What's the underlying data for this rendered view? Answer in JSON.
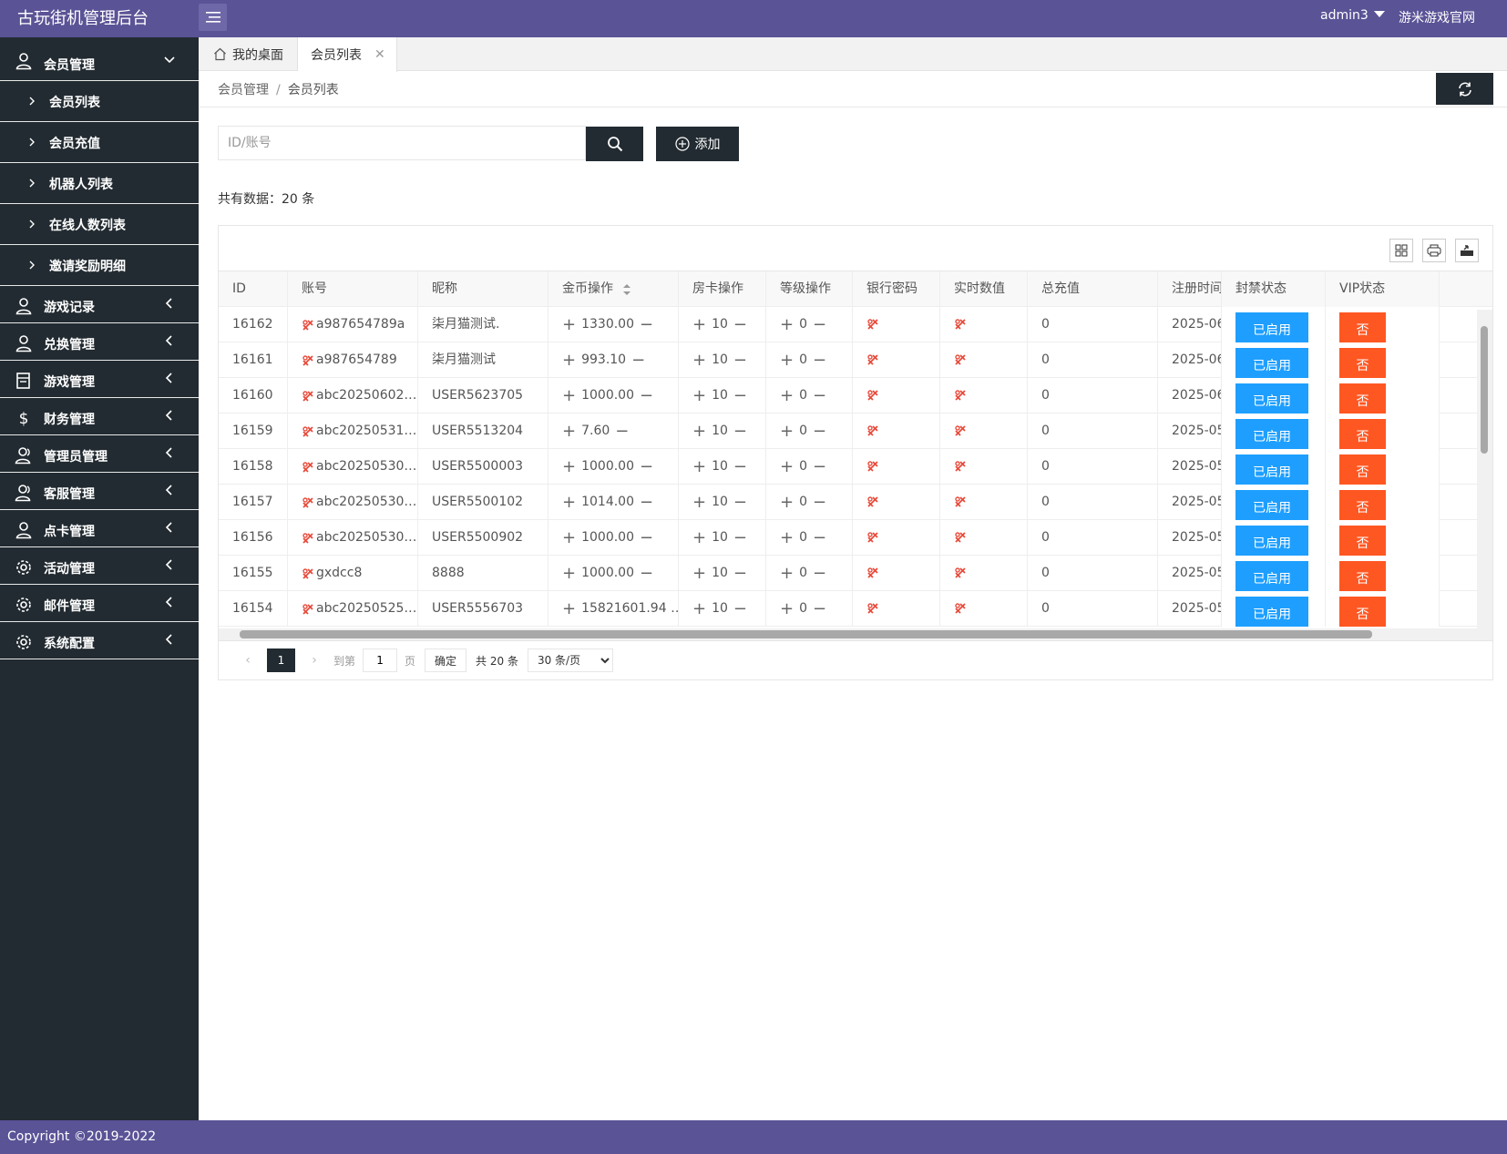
{
  "header": {
    "brand": "古玩街机管理后台",
    "user": "admin3",
    "site_link": "游米游戏官网"
  },
  "sidebar": {
    "groups": [
      {
        "label": "会员管理",
        "icon": "user-icon",
        "expanded": true,
        "children": [
          "会员列表",
          "会员充值",
          "机器人列表",
          "在线人数列表",
          "邀请奖励明细"
        ]
      },
      {
        "label": "游戏记录",
        "icon": "user-icon"
      },
      {
        "label": "兑换管理",
        "icon": "user-icon"
      },
      {
        "label": "游戏管理",
        "icon": "document-icon"
      },
      {
        "label": "财务管理",
        "icon": "dollar-icon"
      },
      {
        "label": "管理员管理",
        "icon": "users-icon"
      },
      {
        "label": "客服管理",
        "icon": "users-icon"
      },
      {
        "label": "点卡管理",
        "icon": "user-icon"
      },
      {
        "label": "活动管理",
        "icon": "gear-icon"
      },
      {
        "label": "邮件管理",
        "icon": "gear-icon"
      },
      {
        "label": "系统配置",
        "icon": "gear-icon"
      }
    ]
  },
  "tabs": {
    "home": "我的桌面",
    "active": "会员列表"
  },
  "breadcrumb": {
    "parent": "会员管理",
    "sep": "/",
    "current": "会员列表"
  },
  "search": {
    "placeholder": "ID/账号",
    "add_label": "添加"
  },
  "total_text": "共有数据：20 条",
  "table": {
    "columns": [
      "ID",
      "账号",
      "昵称",
      "金币操作",
      "房卡操作",
      "等级操作",
      "银行密码",
      "实时数值",
      "总充值",
      "注册时间",
      "封禁状态",
      "VIP状态"
    ],
    "rows": [
      {
        "id": "16162",
        "account": "a987654789a",
        "nickname": "柒月猫测试.",
        "gold": "1330.00",
        "card": "10",
        "level": "0",
        "total": "0",
        "reg": "2025-06-",
        "status": "已启用",
        "vip": "否"
      },
      {
        "id": "16161",
        "account": "a987654789",
        "nickname": "柒月猫测试",
        "gold": "993.10",
        "card": "10",
        "level": "0",
        "total": "0",
        "reg": "2025-06-",
        "status": "已启用",
        "vip": "否"
      },
      {
        "id": "16160",
        "account": "abc20250602…",
        "nickname": "USER5623705",
        "gold": "1000.00",
        "card": "10",
        "level": "0",
        "total": "0",
        "reg": "2025-06-",
        "status": "已启用",
        "vip": "否"
      },
      {
        "id": "16159",
        "account": "abc20250531…",
        "nickname": "USER5513204",
        "gold": "7.60",
        "card": "10",
        "level": "0",
        "total": "0",
        "reg": "2025-05-",
        "status": "已启用",
        "vip": "否"
      },
      {
        "id": "16158",
        "account": "abc20250530…",
        "nickname": "USER5500003",
        "gold": "1000.00",
        "card": "10",
        "level": "0",
        "total": "0",
        "reg": "2025-05-",
        "status": "已启用",
        "vip": "否"
      },
      {
        "id": "16157",
        "account": "abc20250530…",
        "nickname": "USER5500102",
        "gold": "1014.00",
        "card": "10",
        "level": "0",
        "total": "0",
        "reg": "2025-05-",
        "status": "已启用",
        "vip": "否"
      },
      {
        "id": "16156",
        "account": "abc20250530…",
        "nickname": "USER5500902",
        "gold": "1000.00",
        "card": "10",
        "level": "0",
        "total": "0",
        "reg": "2025-05-",
        "status": "已启用",
        "vip": "否"
      },
      {
        "id": "16155",
        "account": "gxdcc8",
        "nickname": "8888",
        "gold": "1000.00",
        "card": "10",
        "level": "0",
        "total": "0",
        "reg": "2025-05-",
        "status": "已启用",
        "vip": "否"
      },
      {
        "id": "16154",
        "account": "abc20250525…",
        "nickname": "USER5556703",
        "gold": "15821601.94 …",
        "card": "10",
        "level": "0",
        "total": "0",
        "reg": "2025-05-",
        "status": "已启用",
        "vip": "否"
      }
    ]
  },
  "pager": {
    "current": "1",
    "goto_prefix": "到第",
    "goto_value": "1",
    "goto_suffix": "页",
    "confirm": "确定",
    "count": "共 20 条",
    "page_size": "30 条/页"
  },
  "footer": "Copyright ©2019-2022",
  "colors": {
    "header_bg": "#5a5396",
    "sidebar_bg": "#222b31",
    "status_blue": "#1e9fff",
    "vip_orange": "#ff5722",
    "icon_red": "#e74c3c"
  }
}
